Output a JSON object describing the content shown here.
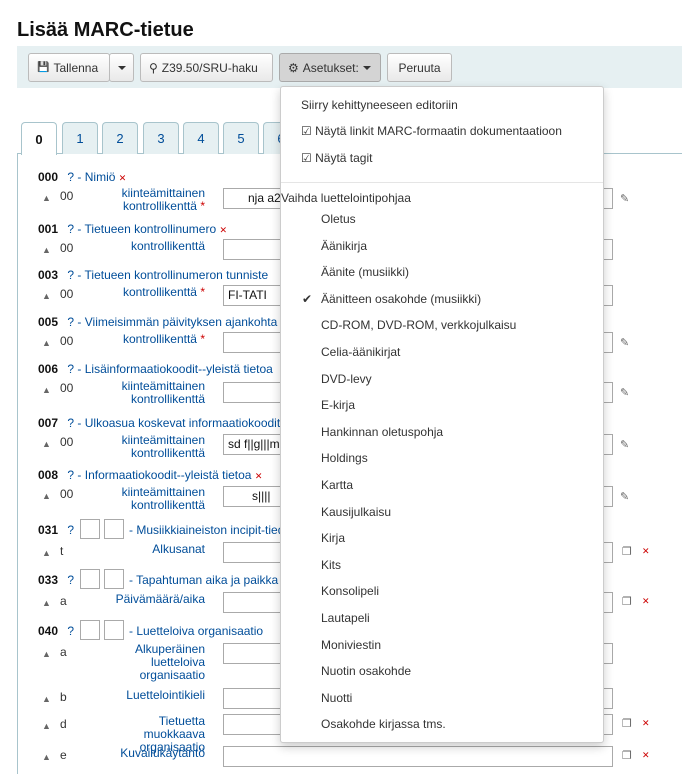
{
  "page": {
    "title": "Lisää MARC-tietue"
  },
  "toolbar": {
    "save": "Tallenna",
    "z3950": "Z39.50/SRU-haku",
    "settings": "Asetukset:",
    "cancel": "Peruuta"
  },
  "tabs": [
    "0",
    "1",
    "2",
    "3",
    "4",
    "5",
    "6"
  ],
  "fields": {
    "f000": {
      "tag": "000",
      "name": "- Nimiö",
      "sub": "00",
      "label1": "kiinteämittainen",
      "label2": "kontrollikenttä",
      "value": "nja a22"
    },
    "f001": {
      "tag": "001",
      "name": "- Tietueen kontrollinumero",
      "sub": "00",
      "label": "kontrollikenttä"
    },
    "f003": {
      "tag": "003",
      "name": "- Tietueen kontrollinumeron tunniste",
      "sub": "00",
      "label": "kontrollikenttä",
      "value": "FI-TATI"
    },
    "f005": {
      "tag": "005",
      "name": "- Viimeisimmän päivityksen ajankohta",
      "sub": "00",
      "label": "kontrollikenttä"
    },
    "f006": {
      "tag": "006",
      "name": "- Lisäinformaatiokoodit--yleistä tietoa",
      "sub": "00",
      "label1": "kiinteämittainen",
      "label2": "kontrollikenttä"
    },
    "f007": {
      "tag": "007",
      "name": "- Ulkoasua koskevat informaatiokoodit",
      "sub": "00",
      "label1": "kiinteämittainen",
      "label2": "kontrollikenttä",
      "value": "sd f||g|||m"
    },
    "f008": {
      "tag": "008",
      "name": "- Informaatiokoodit--yleistä tietoa",
      "sub": "00",
      "label1": "kiinteämittainen",
      "label2": "kontrollikenttä",
      "value": "s||||"
    },
    "f031": {
      "tag": "031",
      "name": "- Musiikkiaineiston incipit-tiedot",
      "sub": "t",
      "label": "Alkusanat"
    },
    "f033": {
      "tag": "033",
      "name": "- Tapahtuman aika ja paikka",
      "sub": "a",
      "label": "Päivämäärä/aika"
    },
    "f040": {
      "tag": "040",
      "name": "- Luetteloiva organisaatio",
      "subs": [
        {
          "code": "a",
          "l1": "Alkuperäinen",
          "l2": "luetteloiva",
          "l3": "organisaatio"
        },
        {
          "code": "b",
          "l1": "Luettelointikieli"
        },
        {
          "code": "d",
          "l1": "Tietuetta muokkaava",
          "l2": "organisaatio"
        },
        {
          "code": "e",
          "l1": "Kuvailukäytäntö"
        }
      ]
    }
  },
  "q": "?",
  "menu": {
    "advanced": "Siirry kehittyneeseen editoriin",
    "doc_links": "Näytä linkit MARC-formaatin dokumentaatioon",
    "show_tags": "Näytä tagit",
    "header": "Vaihda luettelointipohjaa",
    "frameworks": [
      "Oletus",
      "Äänikirja",
      "Äänite (musiikki)",
      "Äänitteen osakohde (musiikki)",
      "CD-ROM, DVD-ROM, verkkojulkaisu",
      "Celia-äänikirjat",
      "DVD-levy",
      "E-kirja",
      "Hankinnan oletuspohja",
      "Holdings",
      "Kartta",
      "Kausijulkaisu",
      "Kirja",
      "Kits",
      "Konsolipeli",
      "Lautapeli",
      "Moniviestin",
      "Nuotin osakohde",
      "Nuotti",
      "Osakohde kirjassa tms."
    ],
    "selected": "Äänitteen osakohde (musiikki)"
  }
}
